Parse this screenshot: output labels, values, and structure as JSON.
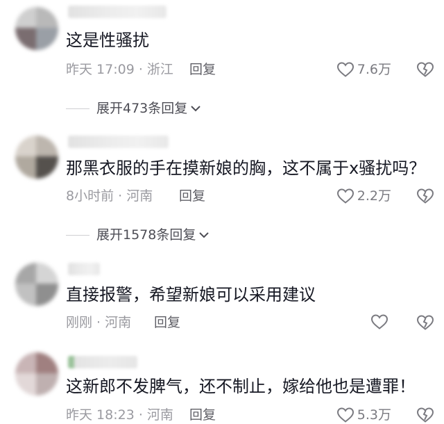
{
  "comments": [
    {
      "text": "这是性骚扰",
      "time_location": "昨天 17:09 · 浙江",
      "reply_label": "回复",
      "like_count": "7.6万",
      "expand_label": "展开473条回复"
    },
    {
      "text": "那黑衣服的手在摸新娘的胸，这不属于x骚扰吗？",
      "time_location": "8小时前 · 河南",
      "reply_label": "回复",
      "like_count": "2.2万",
      "expand_label": "展开1578条回复"
    },
    {
      "text": "直接报警，希望新娘可以采用建议",
      "time_location": "刚刚 · 河南",
      "reply_label": "回复",
      "like_count": ""
    },
    {
      "text": "这新郎不发脾气，还不制止，嫁给他也是遭罪！",
      "time_location": "昨天 18:23 · 河南",
      "reply_label": "回复",
      "like_count": "5.3万"
    }
  ],
  "icons": {
    "like": "heart-outline-icon",
    "dislike": "broken-heart-outline-icon",
    "expand": "chevron-down-icon"
  },
  "colors": {
    "text": "#161823",
    "meta": "#9a9aa0",
    "icon": "#7a7a80"
  }
}
